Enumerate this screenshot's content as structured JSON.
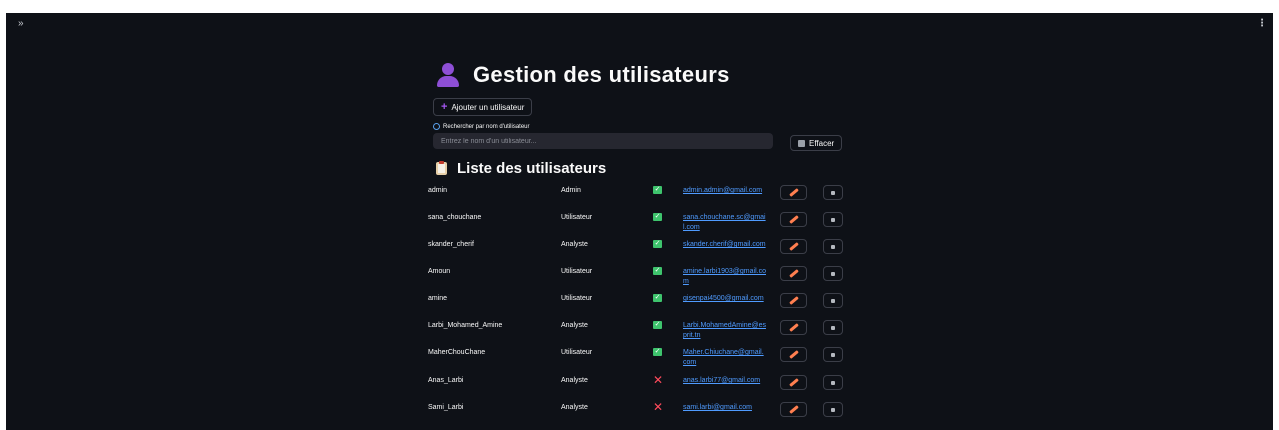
{
  "toolbar": {
    "sidebar_toggle": "»",
    "menu": "⋮"
  },
  "page": {
    "title": "Gestion des utilisateurs",
    "title_icon": "user-silhouette-icon"
  },
  "actions": {
    "add_user_label": "Ajouter un utilisateur",
    "clear_label": "Effacer"
  },
  "search": {
    "label": "Rechercher par nom d'utilisateur",
    "placeholder": "Entrez le nom d'un utilisateur...",
    "value": ""
  },
  "list": {
    "title": "Liste des utilisateurs",
    "rows": [
      {
        "username": "admin",
        "role": "Admin",
        "active": true,
        "email": "admin.admin@gmail.com"
      },
      {
        "username": "sana_chouchane",
        "role": "Utilisateur",
        "active": true,
        "email": "sana.chouchane.sc@gmail.com"
      },
      {
        "username": "skander_cherif",
        "role": "Analyste",
        "active": true,
        "email": "skander.cherif@gmail.com"
      },
      {
        "username": "Amoun",
        "role": "Utilisateur",
        "active": true,
        "email": "amine.larbi1903@gmail.com"
      },
      {
        "username": "amine",
        "role": "Utilisateur",
        "active": true,
        "email": "gisenpai4500@gmail.com"
      },
      {
        "username": "Larbi_Mohamed_Amine",
        "role": "Analyste",
        "active": true,
        "email": "Larbi.MohamedAmine@esprit.tn"
      },
      {
        "username": "MaherChouChane",
        "role": "Utilisateur",
        "active": true,
        "email": "Maher.Chiuchane@gmail.com"
      },
      {
        "username": "Anas_Larbi",
        "role": "Analyste",
        "active": false,
        "email": "anas.larbi77@gmail.com"
      },
      {
        "username": "Sami_Larbi",
        "role": "Analyste",
        "active": false,
        "email": "sami.larbi@gmail.com"
      }
    ]
  },
  "colors": {
    "background": "#0e1117",
    "accent": "#a557f2",
    "link": "#4f9bff",
    "status_ok": "#3ec46d",
    "status_no": "#ff4b5c",
    "edit": "#ff7f50"
  }
}
